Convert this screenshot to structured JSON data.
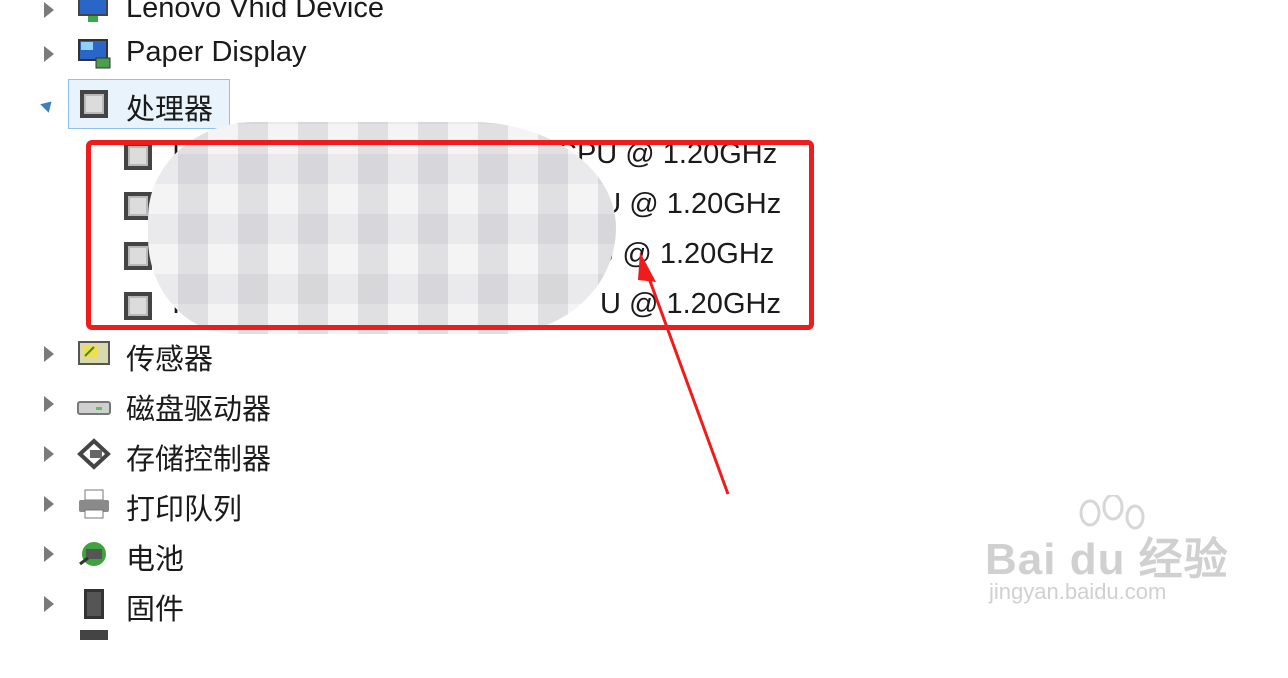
{
  "tree": {
    "categories": [
      {
        "label": "Lenovo Vhid Device",
        "icon": "monitor-network-icon",
        "expanded": false
      },
      {
        "label": "Paper Display",
        "icon": "monitor-icon",
        "expanded": false
      },
      {
        "label": "处理器",
        "icon": "chip-icon",
        "expanded": true,
        "selected": true
      },
      {
        "label": "传感器",
        "icon": "sensor-icon",
        "expanded": false
      },
      {
        "label": "磁盘驱动器",
        "icon": "disk-drive-icon",
        "expanded": false
      },
      {
        "label": "存储控制器",
        "icon": "storage-controller-icon",
        "expanded": false
      },
      {
        "label": "打印队列",
        "icon": "printer-icon",
        "expanded": false
      },
      {
        "label": "电池",
        "icon": "battery-icon",
        "expanded": false
      },
      {
        "label": "固件",
        "icon": "firmware-icon",
        "expanded": false
      }
    ],
    "processors": [
      {
        "label": "In",
        "suffix": "CPU @ 1.20GHz"
      },
      {
        "label": "",
        "suffix": "CPU @ 1.20GHz"
      },
      {
        "label": "",
        "suffix": "PU @ 1.20GHz"
      },
      {
        "label": "In",
        "suffix": "U @ 1.20GHz"
      }
    ]
  },
  "annotation": {
    "highlight_color": "#ee1c1c"
  },
  "watermark": {
    "brand": "Bai du 经验",
    "site": "jingyan.baidu.com"
  }
}
